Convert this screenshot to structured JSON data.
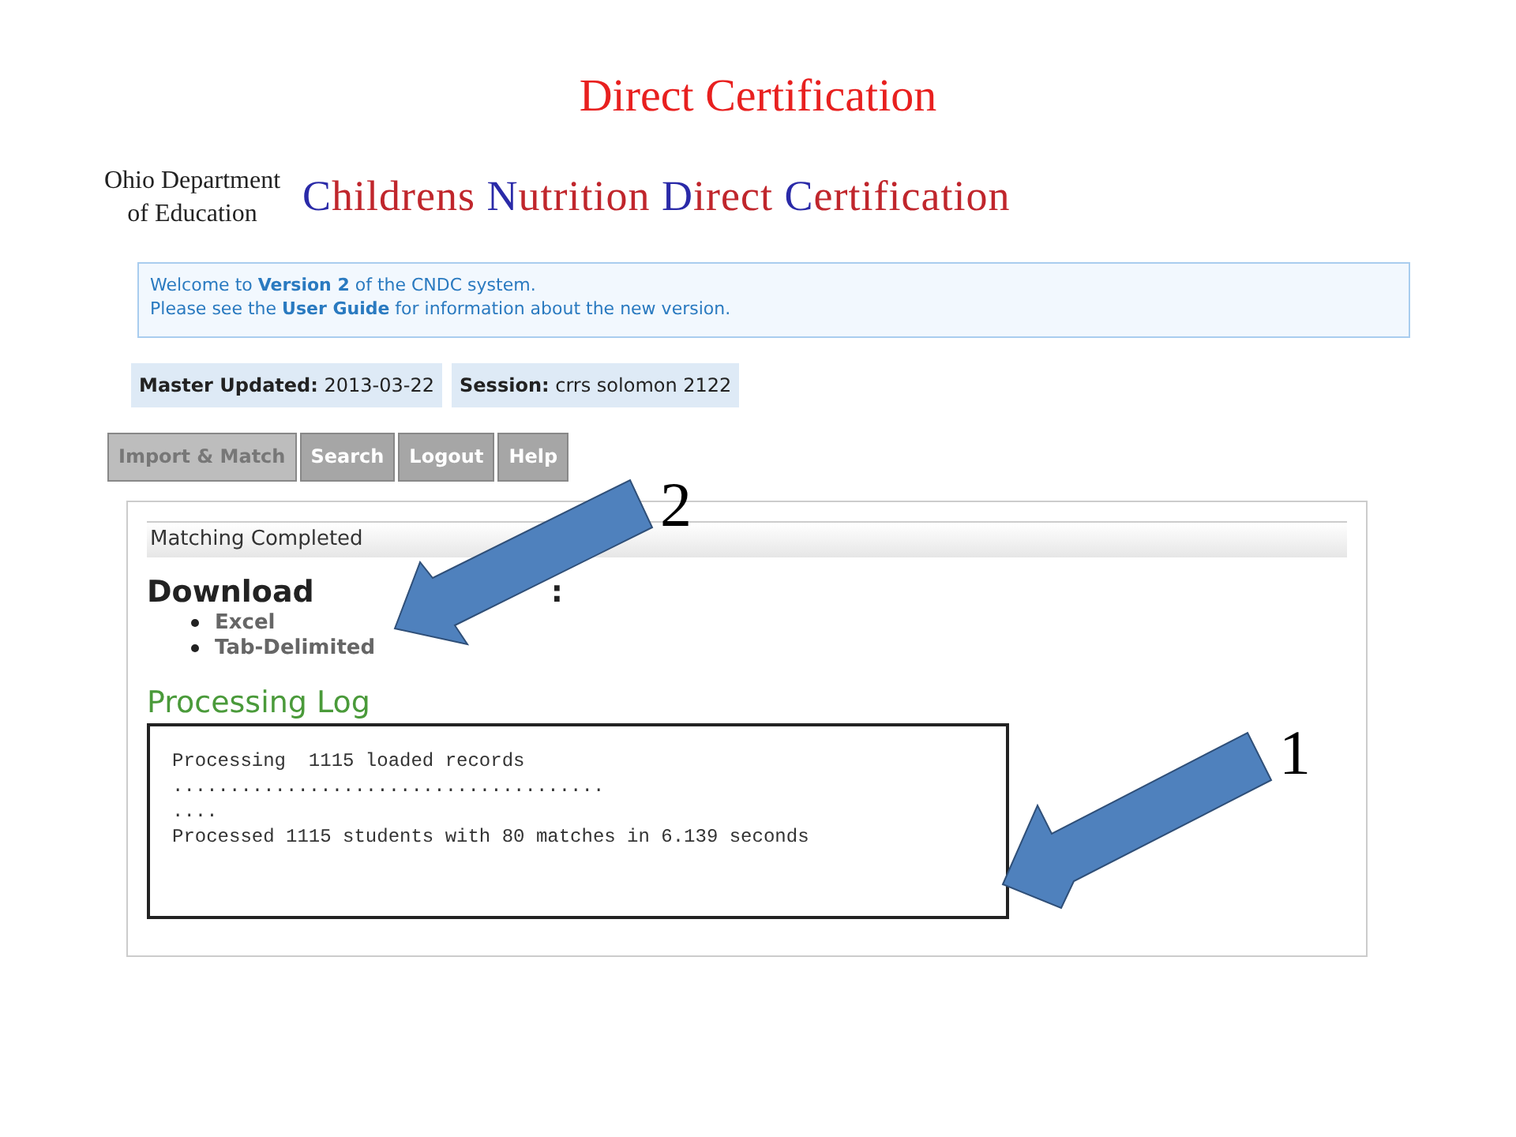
{
  "slide_title": "Direct Certification",
  "logo": {
    "line_1": "Ohio Department",
    "line_2": "of Education"
  },
  "app_title": [
    {
      "text": "C",
      "color": "#2a2aa8"
    },
    {
      "text": "hildrens ",
      "color": "#c0262c"
    },
    {
      "text": "N",
      "color": "#2a2aa8"
    },
    {
      "text": "utrition ",
      "color": "#c0262c"
    },
    {
      "text": "D",
      "color": "#2a2aa8"
    },
    {
      "text": "irect ",
      "color": "#c0262c"
    },
    {
      "text": "C",
      "color": "#2a2aa8"
    },
    {
      "text": "ertification",
      "color": "#c0262c"
    }
  ],
  "notice": {
    "line_1": "Welcome to **Version 2** of the CNDC system.",
    "line_2": "Please see the **User Guide** for information about the new version."
  },
  "status": [
    {
      "label": "Master Updated:",
      "value": "2013-03-22"
    },
    {
      "label": "Session:",
      "value": "crrs solomon 2122"
    }
  ],
  "nav": [
    {
      "label": "Import & Match",
      "selected": true
    },
    {
      "label": "Search",
      "selected": false
    },
    {
      "label": "Logout",
      "selected": false
    },
    {
      "label": "Help",
      "selected": false
    }
  ],
  "panel": {
    "header": "Matching Completed",
    "heading": "Download",
    "heading_end": ":",
    "links": [
      "Excel",
      "Tab-Delimited"
    ],
    "log_title": "Processing Log",
    "log_lines": [
      "Processing  1115 loaded records",
      "......................................",
      "....",
      "Processed 1115 students with 80 matches in 6.139 seconds"
    ]
  },
  "callouts": [
    "2",
    "1"
  ]
}
